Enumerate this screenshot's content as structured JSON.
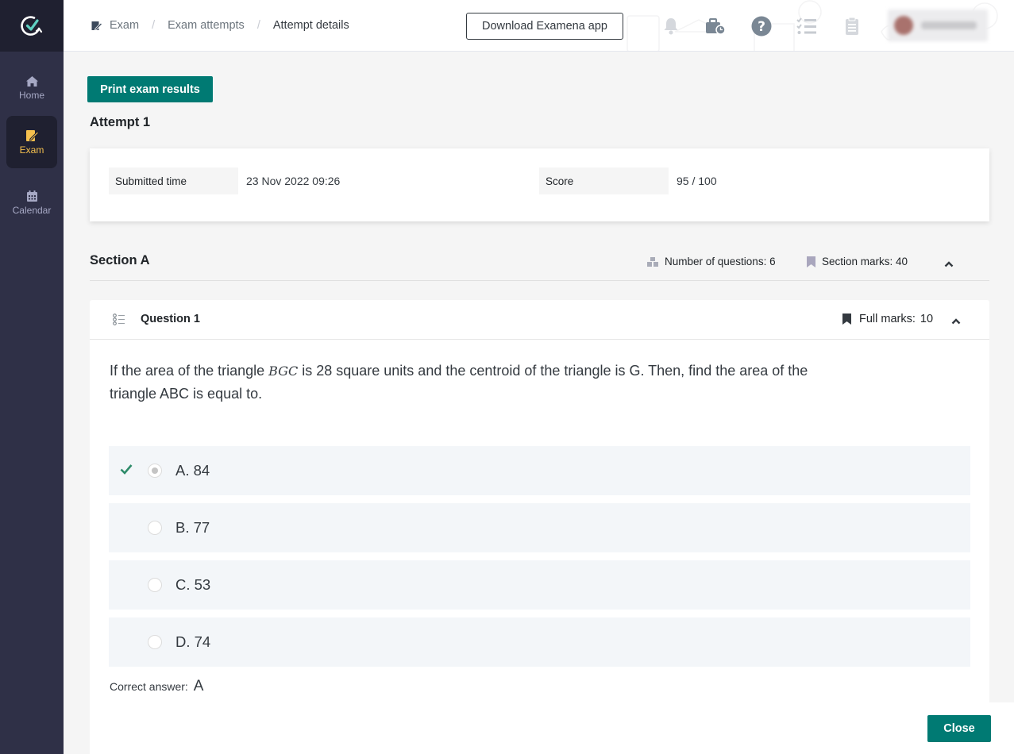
{
  "brand": {
    "logo": "check-circle-logo",
    "accent": "#007a73",
    "active_nav": "#f5c04e"
  },
  "sidebar": {
    "items": [
      {
        "label": "Home",
        "icon": "home-icon",
        "active": false
      },
      {
        "label": "Exam",
        "icon": "exam-edit-icon",
        "active": true
      },
      {
        "label": "Calendar",
        "icon": "calendar-icon",
        "active": false
      }
    ]
  },
  "header": {
    "breadcrumb": [
      {
        "label": "Exam",
        "icon": "exam-edit-icon"
      },
      {
        "label": "Exam attempts"
      },
      {
        "label": "Attempt details"
      }
    ],
    "separator": "/",
    "download_button": "Download Examena app",
    "icons": [
      "bell-icon",
      "briefcase-clock-icon",
      "help-icon",
      "task-list-icon",
      "clipboard-icon"
    ],
    "profile": {
      "redacted": true
    }
  },
  "main": {
    "print_button": "Print exam results",
    "attempt_title": "Attempt 1",
    "summary": {
      "submitted_label": "Submitted time",
      "submitted_value": "23 Nov 2022 09:26",
      "score_label": "Score",
      "score_value": "95 / 100"
    },
    "section": {
      "title": "Section A",
      "num_questions_label": "Number of questions: 6",
      "marks_label": "Section marks: 40"
    },
    "question": {
      "title": "Question 1",
      "full_marks_label": "Full marks:",
      "full_marks_value": "10",
      "text_before": "If the area of the triangle ",
      "text_math": "BGC",
      "text_after": " is 28 square units and the centroid of the triangle is G. Then, find the area of the triangle ABC is equal to.",
      "options": [
        {
          "label": "A. 84",
          "selected": true,
          "correct": true
        },
        {
          "label": "B. 77",
          "selected": false,
          "correct": false
        },
        {
          "label": "C. 53",
          "selected": false,
          "correct": false
        },
        {
          "label": "D. 74",
          "selected": false,
          "correct": false
        }
      ],
      "correct_answer_label": "Correct answer:",
      "correct_answer_value": "A"
    }
  },
  "footer": {
    "close_button": "Close"
  }
}
